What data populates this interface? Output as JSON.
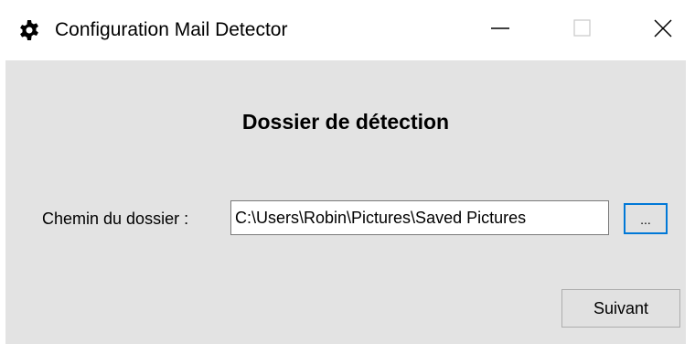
{
  "window": {
    "title": "Configuration Mail Detector",
    "icon": "gear-icon"
  },
  "titlebar_buttons": {
    "minimize_icon": "minimize-icon",
    "maximize_icon": "maximize-icon",
    "close_icon": "close-icon"
  },
  "main": {
    "heading": "Dossier de détection",
    "path_label": "Chemin du dossier :",
    "path_value": "C:\\Users\\Robin\\Pictures\\Saved Pictures",
    "browse_label": "...",
    "next_label": "Suivant"
  },
  "colors": {
    "client_background": "#e3e3e3",
    "focus_border": "#0078d7"
  }
}
